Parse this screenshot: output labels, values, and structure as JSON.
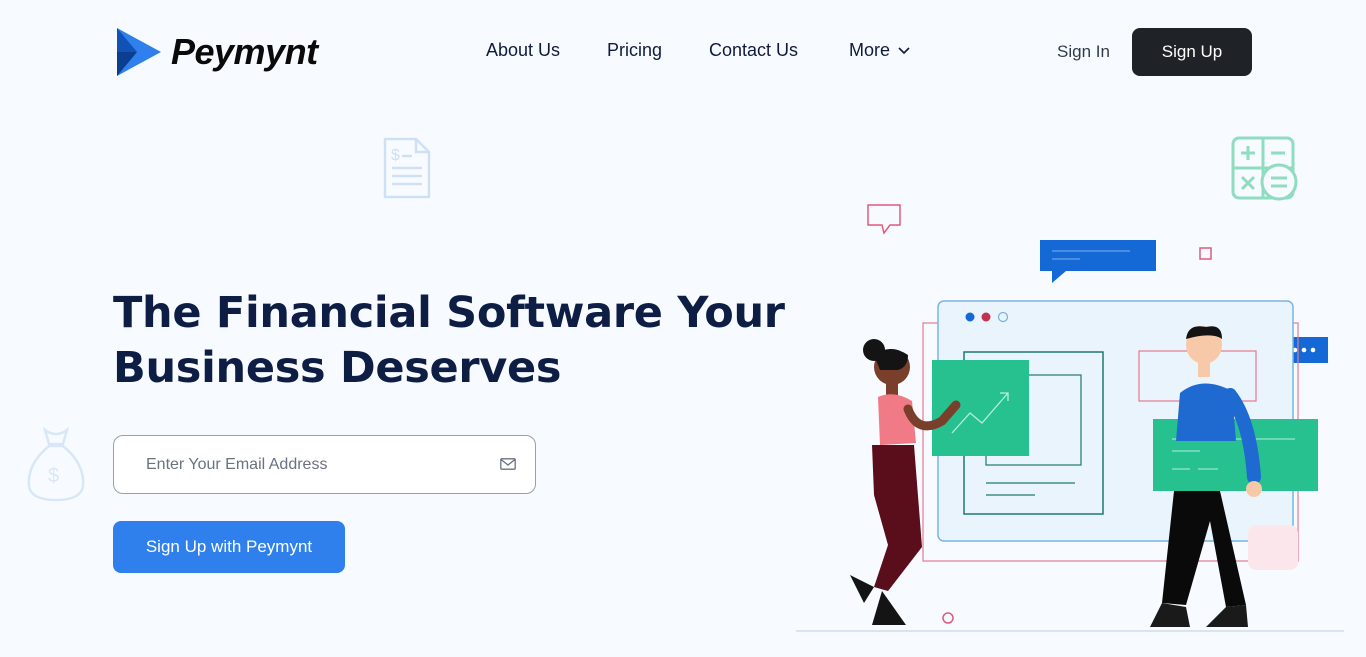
{
  "brand": {
    "name": "Peymynt"
  },
  "nav": {
    "items": [
      {
        "label": "About Us"
      },
      {
        "label": "Pricing"
      },
      {
        "label": "Contact Us"
      },
      {
        "label": "More"
      }
    ]
  },
  "auth": {
    "sign_in": "Sign In",
    "sign_up": "Sign Up"
  },
  "hero": {
    "title_line1": "The Financial Software Your",
    "title_line2": "Business Deserves",
    "email_placeholder": "Enter Your Email Address",
    "cta_label": "Sign Up with Peymynt"
  },
  "colors": {
    "background": "#f7fbff",
    "primary": "#2f80ed",
    "dark": "#1f2226",
    "heading": "#0d1d44",
    "green": "#26c18f",
    "blue": "#1469d6",
    "pink": "#e05a7a"
  },
  "icons": {
    "logo": "play-triangle-logo",
    "more": "chevron-down-icon",
    "email": "mail-icon",
    "decor": [
      "invoice-icon",
      "calculator-icon",
      "money-bag-icon"
    ]
  }
}
